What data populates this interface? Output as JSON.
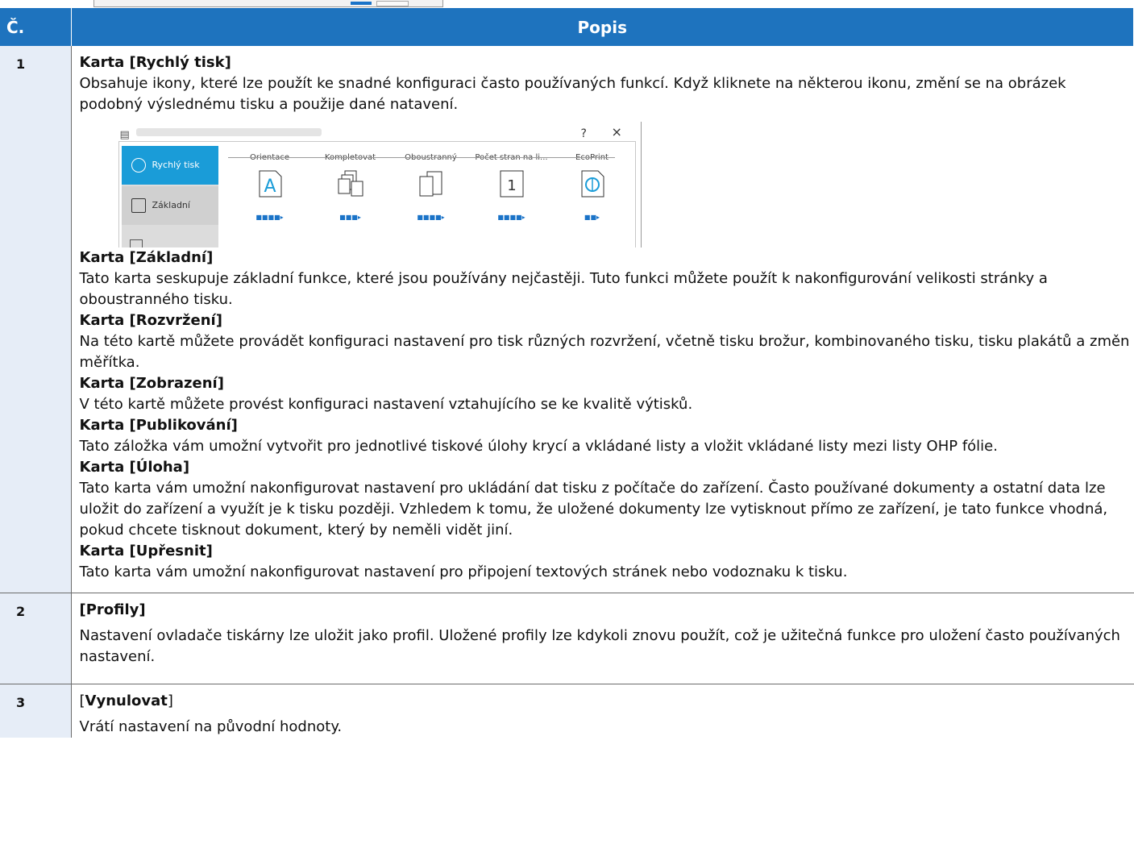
{
  "table": {
    "header": {
      "col_no": "Č.",
      "col_desc": "Popis"
    },
    "rows": [
      {
        "num": "1",
        "sections": [
          {
            "heading": "Karta [Rychlý tisk]",
            "text": "Obsahuje ikony, které lze použít ke snadné konfiguraci často používaných funkcí. Když kliknete na některou ikonu, změní se na obrázek podobný výslednému tisku a použije dané natavení."
          },
          {
            "heading": "Karta [Základní]",
            "text": "Tato karta seskupuje základní funkce, které jsou používány nejčastěji. Tuto funkci můžete použít k nakonfigurování velikosti stránky a oboustranného tisku."
          },
          {
            "heading": "Karta [Rozvržení]",
            "text": "Na této kartě můžete provádět konfiguraci nastavení pro tisk různých rozvržení, včetně tisku brožur, kombinovaného tisku, tisku plakátů a změn měřítka."
          },
          {
            "heading": "Karta [Zobrazení]",
            "text": "V této kartě můžete provést konfiguraci nastavení vztahujícího se ke kvalitě výtisků."
          },
          {
            "heading": "Karta [Publikování]",
            "text": "Tato záložka vám umožní vytvořit pro jednotlivé tiskové úlohy krycí a vkládané listy a vložit vkládané listy mezi listy OHP fólie."
          },
          {
            "heading": "Karta [Úloha]",
            "text": "Tato karta vám umožní nakonfigurovat nastavení pro ukládání dat tisku z počítače do zařízení. Často používané dokumenty a ostatní data lze uložit do zařízení a využít je k tisku později. Vzhledem k tomu, že uložené dokumenty lze vytisknout přímo ze zařízení, je tato funkce vhodná, pokud chcete tisknout dokument, který by neměli vidět jiní."
          },
          {
            "heading": "Karta [Upřesnit]",
            "text": "Tato karta vám umožní nakonfigurovat nastavení pro připojení textových stránek nebo vodoznaku k tisku."
          }
        ]
      },
      {
        "num": "2",
        "heading": "[Profily]",
        "text": "Nastavení ovladače tiskárny lze uložit jako profil. Uložené profily lze kdykoli znovu použít, což je užitečná funkce pro uložení často používaných nastavení."
      },
      {
        "num": "3",
        "heading_pre": "[",
        "heading": "Vynulovat",
        "heading_post": "]",
        "text": "Vrátí nastavení na původní hodnoty."
      }
    ]
  },
  "dialog": {
    "help": "?",
    "close": "×",
    "sidebar": [
      "Rychlý tisk",
      "Základní"
    ],
    "tabs": [
      "Orientace",
      "Kompletovat",
      "Oboustranný",
      "Počet stran na li...",
      "EcoPrint"
    ],
    "icon_labels": [
      "A",
      "1"
    ],
    "accent_color": "#1a9cd8"
  }
}
